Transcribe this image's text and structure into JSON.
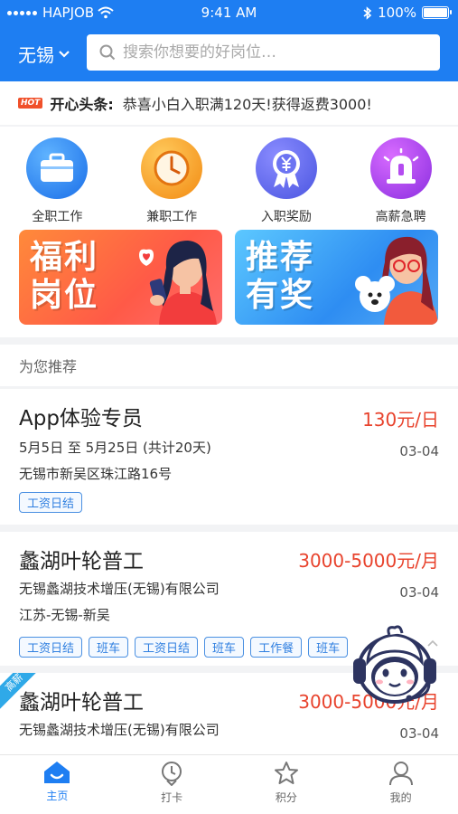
{
  "status_bar": {
    "carrier": "HAPJOB",
    "time": "9:41 AM",
    "battery": "100%"
  },
  "header": {
    "city": "无锡",
    "search_placeholder": "搜索你想要的好岗位…"
  },
  "headline": {
    "badge": "HOT",
    "label": "开心头条:",
    "text": "恭喜小白入职满120天!获得返费3000!"
  },
  "categories": [
    {
      "label": "全职工作",
      "icon": "briefcase-icon"
    },
    {
      "label": "兼职工作",
      "icon": "clock-icon"
    },
    {
      "label": "入职奖励",
      "icon": "yen-medal-icon"
    },
    {
      "label": "高薪急聘",
      "icon": "siren-icon"
    }
  ],
  "banners": [
    {
      "title": "福利岗位"
    },
    {
      "title": "推荐有奖"
    }
  ],
  "recommend_title": "为您推荐",
  "jobs": [
    {
      "title": "App体验专员",
      "salary": "130元/日",
      "line1": "5月5日 至 5月25日 (共计20天)",
      "line2": "无锡市新吴区珠江路16号",
      "date": "03-04",
      "tags": [
        "工资日结"
      ]
    },
    {
      "title": "蠡湖叶轮普工",
      "salary": "3000-5000元/月",
      "line1": "无锡蠡湖技术增压(无锡)有限公司",
      "line2": "江苏-无锡-新吴",
      "date": "03-04",
      "tags": [
        "工资日结",
        "班车",
        "工资日结",
        "班车",
        "工作餐",
        "班车"
      ]
    },
    {
      "ribbon": "高薪",
      "title": "蠡湖叶轮普工",
      "salary": "3000-5000元/月",
      "line1": "无锡蠡湖技术增压(无锡)有限公司",
      "date": "03-04"
    }
  ],
  "tabs": [
    {
      "label": "主页",
      "icon": "home-icon",
      "active": true
    },
    {
      "label": "打卡",
      "icon": "clock-in-icon"
    },
    {
      "label": "积分",
      "icon": "star-icon"
    },
    {
      "label": "我的",
      "icon": "profile-icon"
    }
  ],
  "colors": {
    "primary": "#1e7ef2",
    "salary": "#e8432d",
    "tag": "#2f7fe0"
  }
}
